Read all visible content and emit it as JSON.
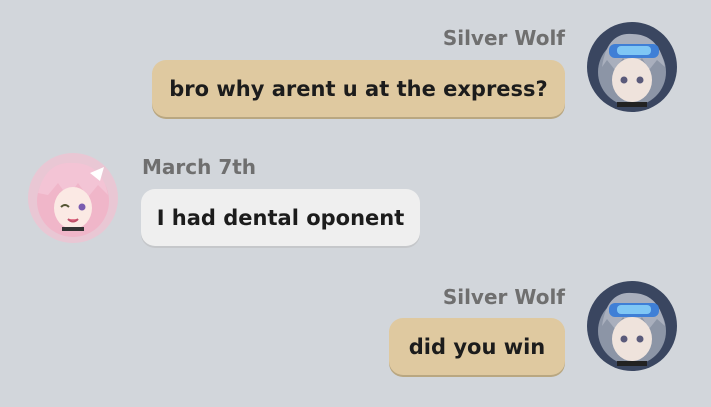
{
  "messages": [
    {
      "sender": "Silver Wolf",
      "text": "bro why arent u at the express?",
      "side": "right",
      "avatar": "silver-wolf-avatar"
    },
    {
      "sender": "March 7th",
      "text": "I had dental oponent",
      "side": "left",
      "avatar": "march-7th-avatar"
    },
    {
      "sender": "Silver Wolf",
      "text": "did you win",
      "side": "right",
      "avatar": "silver-wolf-avatar"
    }
  ],
  "colors": {
    "background": "#d2d6db",
    "sent_bubble": "#dfc9a0",
    "received_bubble": "#efefef",
    "name_text": "#6f6f6f"
  }
}
